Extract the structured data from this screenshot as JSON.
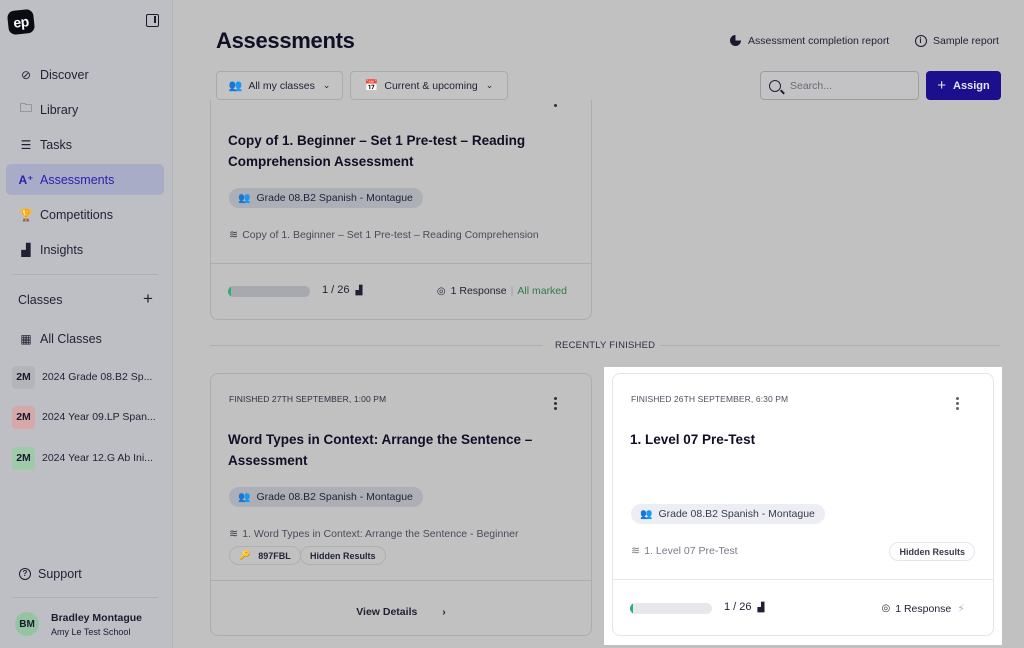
{
  "app": {
    "logo_text": "ep"
  },
  "sidebar": {
    "nav": [
      {
        "label": "Discover",
        "icon": "compass-icon",
        "glyph": "⊘"
      },
      {
        "label": "Library",
        "icon": "folder-icon",
        "glyph": "🗀"
      },
      {
        "label": "Tasks",
        "icon": "task-list-icon",
        "glyph": "☰"
      },
      {
        "label": "Assessments",
        "icon": "assessment-icon",
        "glyph": "A⁺",
        "active": true
      },
      {
        "label": "Competitions",
        "icon": "trophy-icon",
        "glyph": "🏆"
      },
      {
        "label": "Insights",
        "icon": "bar-chart-icon",
        "glyph": "▟"
      }
    ],
    "classes_heading": "Classes",
    "add_class_glyph": "+",
    "all_classes_label": "All Classes",
    "all_classes_glyph": "▦",
    "classes": [
      {
        "initials": "2M",
        "name": "2024 Grade 08.B2 Sp...",
        "color": "#b4b5ba"
      },
      {
        "initials": "2M",
        "name": "2024 Year 09.LP Span...",
        "color": "#d6a8a8"
      },
      {
        "initials": "2M",
        "name": "2024 Year 12.G Ab Ini...",
        "color": "#9fcaa9"
      }
    ],
    "support_label": "Support",
    "support_glyph": "?",
    "user": {
      "initials": "BM",
      "name": "Bradley Montague",
      "school": "Amy Le Test School"
    }
  },
  "header": {
    "title": "Assessments",
    "completion_report_label": "Assessment completion report",
    "sample_report_label": "Sample report",
    "sample_report_glyph": "i",
    "filters": [
      {
        "label": "All my classes",
        "glyph": "👥"
      },
      {
        "label": "Current & upcoming",
        "glyph": "📅"
      }
    ],
    "chevron_glyph": "⌄",
    "search_placeholder": "Search...",
    "assign_label": "Assign",
    "assign_glyph": "+"
  },
  "current_cards": [
    {
      "title": "Copy of 1. Beginner – Set 1 Pre-test – Reading Comprehension Assessment",
      "class_chip": "Grade 08.B2 Spanish - Montague",
      "source": "Copy of 1. Beginner – Set 1 Pre-test – Reading Comprehension",
      "progress_fraction": 0.0385,
      "count": "1 / 26",
      "responses": "1 Response",
      "separator": "|",
      "marked_status": "All marked"
    }
  ],
  "section_label": "RECENTLY FINISHED",
  "finished_cards": [
    {
      "date": "FINISHED 27TH SEPTEMBER, 1:00 PM",
      "title": "Word Types in Context: Arrange the Sentence – Assessment",
      "class_chip": "Grade 08.B2 Spanish - Montague",
      "source": "1. Word Types in Context: Arrange the Sentence - Beginner",
      "code": "897FBL",
      "results_pill": "Hidden Results",
      "view_details_label": "View Details",
      "view_details_glyph": "›"
    },
    {
      "date": "FINISHED 26TH SEPTEMBER, 6:30 PM",
      "title": "1. Level 07 Pre-Test",
      "class_chip": "Grade 08.B2 Spanish - Montague",
      "source": "1. Level 07 Pre-Test",
      "results_pill": "Hidden Results",
      "progress_fraction": 0.0385,
      "count": "1 / 26",
      "responses": "1 Response",
      "highlighted": true
    }
  ],
  "glyphs": {
    "class_chip": "👥",
    "source": "≋",
    "key": "🔑",
    "chart": "▟",
    "comment": "◎",
    "bolt": "⚡"
  },
  "colors": {
    "accent": "#1b0f8d",
    "active_nav_text": "#2b20b0",
    "progress_fill": "#27b27a",
    "marked_green": "#2f7a47",
    "overlay": "#c1c1c1"
  }
}
